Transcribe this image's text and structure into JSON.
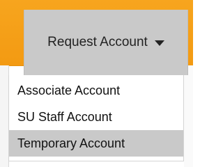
{
  "request_menu": {
    "toggle_label": "Request Account",
    "toggle_icon": "caret-down-icon",
    "items": [
      {
        "label": "Associate Account",
        "highlighted": false
      },
      {
        "label": "SU Staff Account",
        "highlighted": false
      },
      {
        "label": "Temporary Account",
        "highlighted": true
      }
    ]
  },
  "colors": {
    "header_orange": "#f39a12",
    "toggle_gray": "#c9c9c9",
    "highlight_gray": "#c9c9c9"
  }
}
